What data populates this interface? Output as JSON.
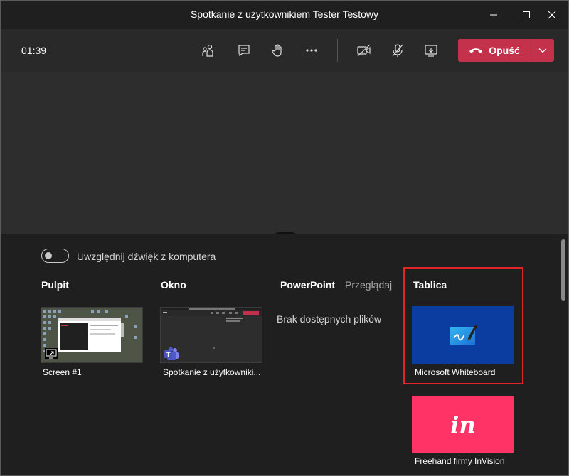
{
  "window": {
    "title": "Spotkanie z użytkownikiem Tester Testowy"
  },
  "toolbar": {
    "timer": "01:39",
    "icons": [
      "people-icon",
      "chat-icon",
      "raise-hand-icon",
      "more-icon",
      "camera-off-icon",
      "mic-off-icon",
      "share-tray-icon"
    ],
    "leave_label": "Opuść",
    "leave_color": "#c4314b"
  },
  "share": {
    "toggle_label": "Uwzględnij dźwięk z komputera",
    "toggle_on": false,
    "sections": {
      "desktop": "Pulpit",
      "window": "Okno",
      "powerpoint": "PowerPoint",
      "browse": "Przeglądaj",
      "whiteboard": "Tablica"
    },
    "desktop_item": "Screen #1",
    "window_item": "Spotkanie z użytkowniki...",
    "no_files": "Brak dostępnych plików",
    "apps": [
      {
        "label": "Microsoft Whiteboard",
        "color": "#0b3da0"
      },
      {
        "label": "Freehand firmy InVision",
        "logo": "in",
        "color": "#ff3366"
      }
    ]
  }
}
